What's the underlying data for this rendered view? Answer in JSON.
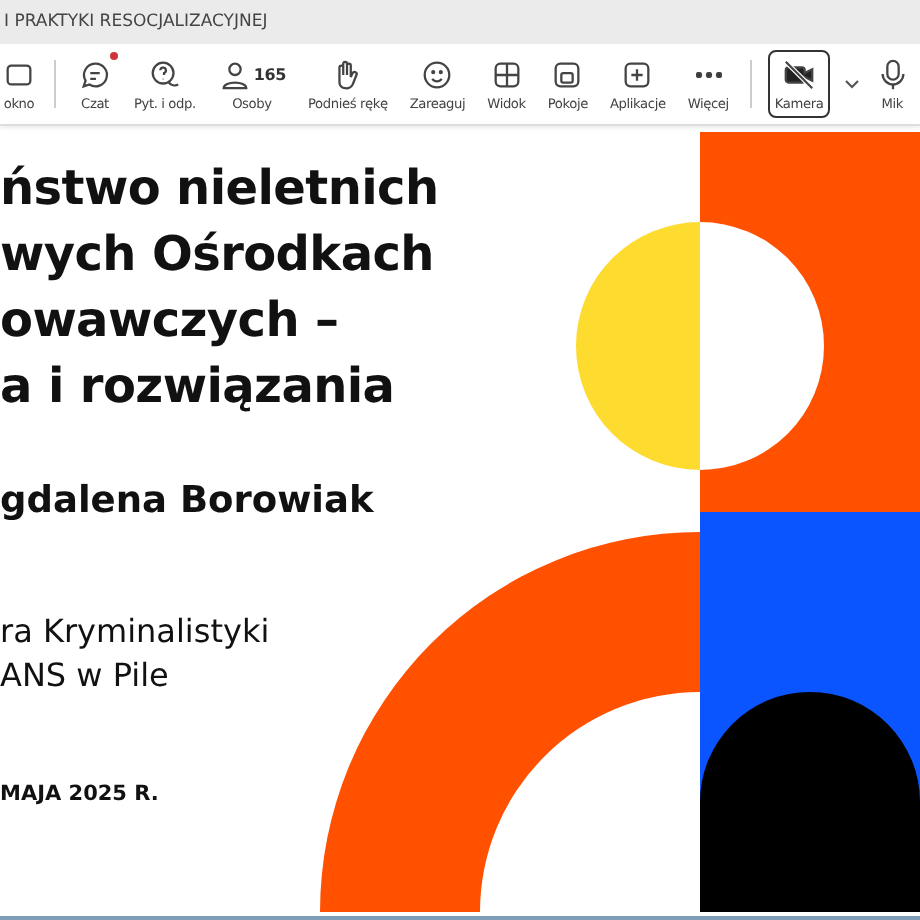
{
  "window": {
    "title": "I PRAKTYKI RESOCJALIZACYJNEJ"
  },
  "toolbar": {
    "items": [
      {
        "kind": "window",
        "label": "okno",
        "selected": false
      },
      {
        "kind": "chat",
        "label": "Czat",
        "notification": true,
        "selected": false
      },
      {
        "kind": "qa",
        "label": "Pyt. i odp.",
        "selected": false
      },
      {
        "kind": "people",
        "label": "Osoby",
        "count": "165",
        "selected": false
      },
      {
        "kind": "hand",
        "label": "Podnieś rękę",
        "selected": false
      },
      {
        "kind": "react",
        "label": "Zareaguj",
        "selected": false
      },
      {
        "kind": "view",
        "label": "Widok",
        "selected": false
      },
      {
        "kind": "rooms",
        "label": "Pokoje",
        "selected": false
      },
      {
        "kind": "apps",
        "label": "Aplikacje",
        "selected": false
      },
      {
        "kind": "more",
        "label": "Więcej",
        "selected": false
      },
      {
        "kind": "camera",
        "label": "Kamera",
        "selected": true
      },
      {
        "kind": "mic",
        "label": "Mik",
        "selected": false
      }
    ]
  },
  "slide": {
    "title_lines": [
      "ństwo nieletnich",
      "wych Ośrodkach",
      "owawczych –",
      "a i rozwiązania"
    ],
    "author": "gdalena Borowiak",
    "affiliation_lines": [
      "ra Kryminalistyki",
      "ANS w Pile"
    ],
    "date": "MAJA 2025 R."
  }
}
